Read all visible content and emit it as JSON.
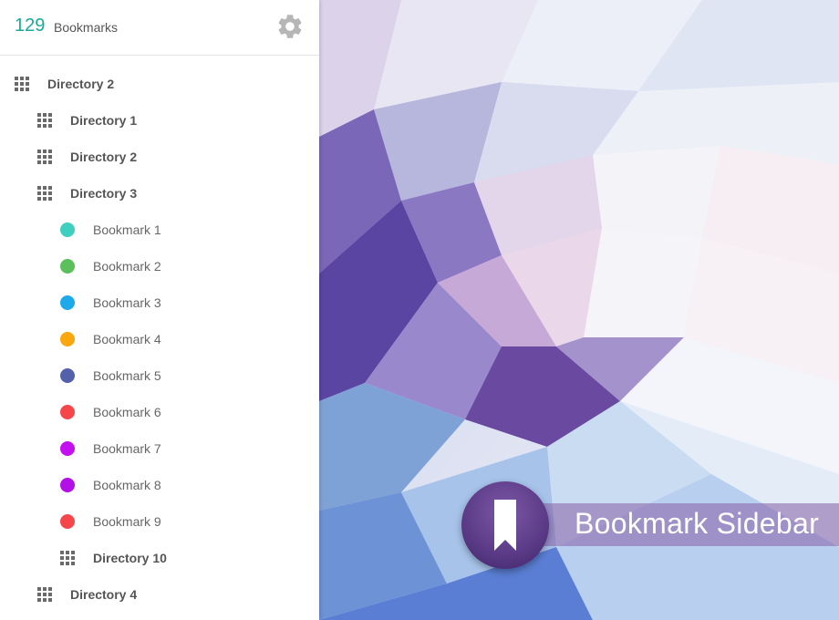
{
  "header": {
    "count": "129",
    "count_label": "Bookmarks",
    "settings_icon": "gear-icon"
  },
  "tree": [
    {
      "type": "directory",
      "label": "Directory 2",
      "depth": 0
    },
    {
      "type": "directory",
      "label": "Directory 1",
      "depth": 1
    },
    {
      "type": "directory",
      "label": "Directory 2",
      "depth": 1
    },
    {
      "type": "directory",
      "label": "Directory 3",
      "depth": 1
    },
    {
      "type": "bookmark",
      "label": "Bookmark 1",
      "depth": 2,
      "color": "#3fcfbf"
    },
    {
      "type": "bookmark",
      "label": "Bookmark 2",
      "depth": 2,
      "color": "#5bbf5a"
    },
    {
      "type": "bookmark",
      "label": "Bookmark 3",
      "depth": 2,
      "color": "#1ea9ea"
    },
    {
      "type": "bookmark",
      "label": "Bookmark 4",
      "depth": 2,
      "color": "#f9a70e"
    },
    {
      "type": "bookmark",
      "label": "Bookmark 5",
      "depth": 2,
      "color": "#5361aa"
    },
    {
      "type": "bookmark",
      "label": "Bookmark 6",
      "depth": 2,
      "color": "#f5464a"
    },
    {
      "type": "bookmark",
      "label": "Bookmark 7",
      "depth": 2,
      "color": "#c40ff0"
    },
    {
      "type": "bookmark",
      "label": "Bookmark 8",
      "depth": 2,
      "color": "#b40fe6"
    },
    {
      "type": "bookmark",
      "label": "Bookmark 9",
      "depth": 2,
      "color": "#f5464a"
    },
    {
      "type": "directory",
      "label": "Directory 10",
      "depth": 2
    },
    {
      "type": "directory",
      "label": "Directory 4",
      "depth": 1
    }
  ],
  "badge": {
    "title": "Bookmark Sidebar",
    "icon": "bookmark-icon"
  },
  "colors": {
    "accent": "#1aa99a",
    "badge_purple": "#5a3a86"
  }
}
